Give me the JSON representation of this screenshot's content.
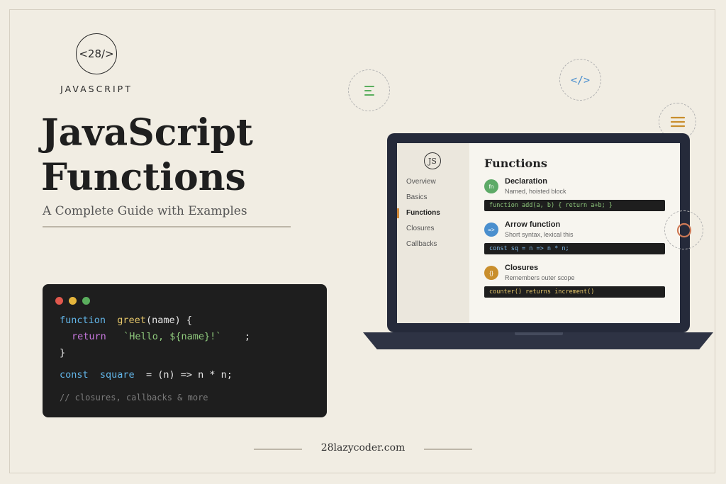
{
  "brand": {
    "logo_text": "<28/>",
    "name": "JAVASCRIPT"
  },
  "hero": {
    "title_line1": "JavaScript",
    "title_line2": "Functions",
    "subtitle": "A Complete Guide with Examples"
  },
  "code_card": {
    "l1_kw": "function",
    "l1_fn": "greet",
    "l1_rest": "(name) {",
    "l2_kw": "return",
    "l2_str": "`Hello, ${name}!`",
    "l2_end": ";",
    "l3": "}",
    "l4_kw": "const",
    "l4_fn": "square",
    "l4_rest": "= (n) => n * n;",
    "comment": "// closures, callbacks & more"
  },
  "float_icons": [
    "list-icon",
    "code-icon",
    "menu-icon",
    "ring-icon"
  ],
  "float_code_icon_text": "</>",
  "laptop": {
    "badge": "JS",
    "nav": [
      "Overview",
      "Basics",
      "Functions",
      "Closures",
      "Callbacks"
    ],
    "active_nav": "Functions",
    "title": "Functions",
    "sections": [
      {
        "icon": "fn",
        "heading": "Declaration",
        "desc": "Named, hoisted block",
        "code": "function add(a, b) { return a+b; }",
        "color": "#5daa67"
      },
      {
        "icon": "=>",
        "heading": "Arrow function",
        "desc": "Short syntax, lexical this",
        "code": "const sq = n => n * n;",
        "color": "#4a8fce"
      },
      {
        "icon": "{}",
        "heading": "Closures",
        "desc": "Remembers outer scope",
        "code": "counter() returns increment()",
        "color": "#c98e2c"
      }
    ]
  },
  "footer": {
    "site": "28lazycoder.com"
  },
  "colors": {
    "background": "#f1ede3",
    "code_bg": "#1e1e1e",
    "laptop": "#252a3a"
  }
}
